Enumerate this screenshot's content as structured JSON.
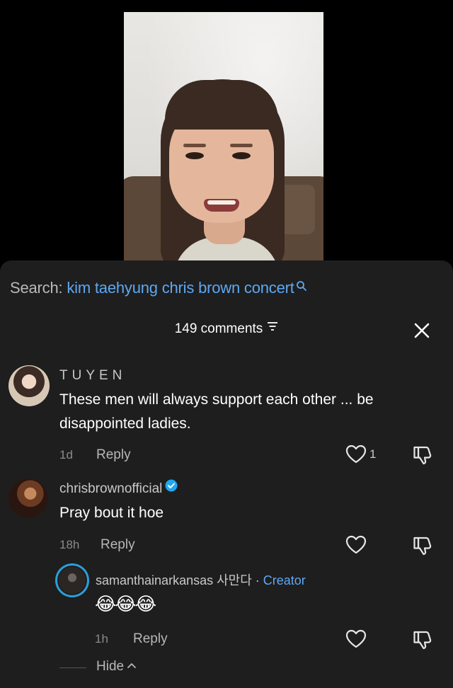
{
  "search": {
    "prefix": "Search:",
    "term": "kim taehyung chris brown concert"
  },
  "comments_header": {
    "count_label": "149 comments"
  },
  "comments": [
    {
      "username": "TUYEN",
      "text": "These men will always support each other ... be disappointed ladies.",
      "time": "1d",
      "reply_label": "Reply",
      "likes": "1"
    },
    {
      "username": "chrisbrownofficial",
      "verified": true,
      "text": "Pray bout it hoe",
      "time": "18h",
      "reply_label": "Reply",
      "replies": [
        {
          "username": "samanthainarkansas 사만다",
          "separator": " · ",
          "badge": "Creator",
          "text": "😂😂😂",
          "time": "1h",
          "reply_label": "Reply"
        }
      ],
      "hide_label": "Hide"
    }
  ],
  "colors": {
    "panel_bg": "#1e1e1e",
    "link_blue": "#5ea8f2",
    "verified_blue": "#20a7f0"
  },
  "icons": [
    "search-icon",
    "filter-icon",
    "close-icon",
    "heart-icon",
    "dislike-icon",
    "verified-icon",
    "chevron-up-icon"
  ]
}
